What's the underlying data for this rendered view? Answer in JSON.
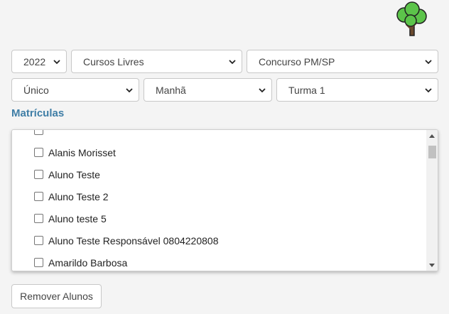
{
  "filters": {
    "year": "2022",
    "course_type": "Cursos Livres",
    "course": "Concurso PM/SP",
    "module": "Único",
    "shift": "Manhã",
    "class": "Turma 1"
  },
  "section_title": "Matrículas",
  "students": [
    "",
    "Alanis Morisset",
    "Aluno Teste",
    "Aluno Teste 2",
    "Aluno teste 5",
    "Aluno Teste Responsável 0804220808",
    "Amarildo Barbosa"
  ],
  "remove_button": "Remover Alunos",
  "icons": {
    "logo": "tree-icon",
    "select": "chevron-down-icon",
    "scroll_up": "scroll-up-arrow-icon",
    "scroll_down": "scroll-down-arrow-icon"
  },
  "colors": {
    "accent": "#3f7ea6",
    "tree_green": "#5cc44a",
    "tree_trunk": "#6b4a2e"
  }
}
